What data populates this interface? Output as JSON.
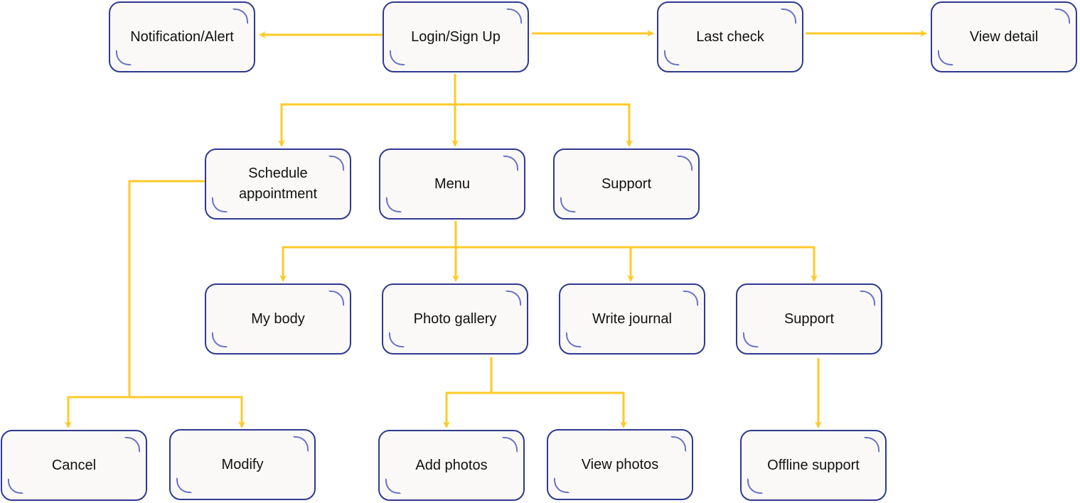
{
  "diagram": {
    "colors": {
      "connector": "#ffca28",
      "node_border": "#2f3a8f",
      "node_fill": "#faf9f8",
      "corner_accent": "#6a72c6"
    },
    "nodes": [
      {
        "id": "notification-alert",
        "label": "Notification/Alert"
      },
      {
        "id": "login-signup",
        "label": "Login/Sign Up"
      },
      {
        "id": "last-check",
        "label": "Last check"
      },
      {
        "id": "view-detail",
        "label": "View detail"
      },
      {
        "id": "schedule-appointment",
        "label": "Schedule\nappointment"
      },
      {
        "id": "menu",
        "label": "Menu"
      },
      {
        "id": "support-top",
        "label": "Support"
      },
      {
        "id": "my-body",
        "label": "My body"
      },
      {
        "id": "photo-gallery",
        "label": "Photo gallery"
      },
      {
        "id": "write-journal",
        "label": "Write journal"
      },
      {
        "id": "support-menu",
        "label": "Support"
      },
      {
        "id": "cancel",
        "label": "Cancel"
      },
      {
        "id": "modify",
        "label": "Modify"
      },
      {
        "id": "add-photos",
        "label": "Add photos"
      },
      {
        "id": "view-photos",
        "label": "View photos"
      },
      {
        "id": "offline-support",
        "label": "Offline support"
      }
    ],
    "edges": [
      {
        "from": "login-signup",
        "to": "notification-alert"
      },
      {
        "from": "login-signup",
        "to": "last-check"
      },
      {
        "from": "last-check",
        "to": "view-detail"
      },
      {
        "from": "login-signup",
        "to": "schedule-appointment"
      },
      {
        "from": "login-signup",
        "to": "menu"
      },
      {
        "from": "login-signup",
        "to": "support-top"
      },
      {
        "from": "menu",
        "to": "my-body"
      },
      {
        "from": "menu",
        "to": "photo-gallery"
      },
      {
        "from": "menu",
        "to": "write-journal"
      },
      {
        "from": "menu",
        "to": "support-menu"
      },
      {
        "from": "schedule-appointment",
        "to": "cancel"
      },
      {
        "from": "schedule-appointment",
        "to": "modify"
      },
      {
        "from": "photo-gallery",
        "to": "add-photos"
      },
      {
        "from": "photo-gallery",
        "to": "view-photos"
      },
      {
        "from": "support-menu",
        "to": "offline-support"
      }
    ]
  }
}
